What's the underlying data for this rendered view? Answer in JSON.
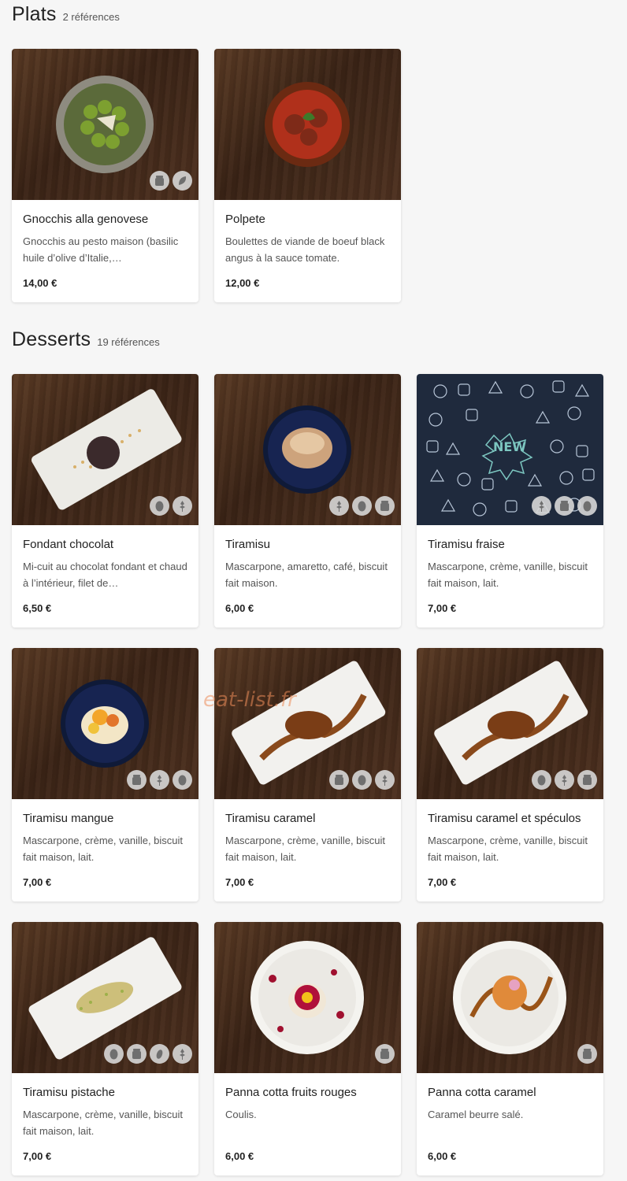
{
  "sections": {
    "plats": {
      "title": "Plats",
      "count": "2 références"
    },
    "desserts": {
      "title": "Desserts",
      "count": "19 références"
    }
  },
  "items": [
    {
      "name": "Gnocchis alla genovese",
      "desc": "Gnocchis au pesto maison (basilic huile d’olive d’Italie,…",
      "price": "14,00 €",
      "badges": [
        "jar-icon",
        "leaf-icon"
      ]
    },
    {
      "name": "Polpete",
      "desc": "Boulettes de viande de boeuf black angus à la sauce tomate.",
      "price": "12,00 €",
      "badges": []
    },
    {
      "name": "Fondant chocolat",
      "desc": "Mi-cuit au chocolat fondant et chaud à l’intérieur, filet de…",
      "price": "6,50 €",
      "badges": [
        "egg-icon",
        "wheat-icon"
      ]
    },
    {
      "name": "Tiramisu",
      "desc": "Mascarpone, amaretto, café, biscuit fait maison.",
      "price": "6,00 €",
      "badges": [
        "wheat-icon",
        "egg-icon",
        "jar-icon"
      ]
    },
    {
      "name": "Tiramisu fraise",
      "desc": "Mascarpone, crème, vanille, biscuit fait maison, lait.",
      "price": "7,00 €",
      "badges": [
        "wheat-icon",
        "jar-icon",
        "egg-icon"
      ]
    },
    {
      "name": "Tiramisu mangue",
      "desc": "Mascarpone, crème, vanille, biscuit fait maison, lait.",
      "price": "7,00 €",
      "badges": [
        "jar-icon",
        "wheat-icon",
        "egg-icon"
      ]
    },
    {
      "name": "Tiramisu caramel",
      "desc": "Mascarpone, crème, vanille, biscuit fait maison, lait.",
      "price": "7,00 €",
      "badges": [
        "jar-icon",
        "egg-icon",
        "wheat-icon"
      ]
    },
    {
      "name": "Tiramisu caramel et spéculos",
      "desc": "Mascarpone, crème, vanille, biscuit fait maison, lait.",
      "price": "7,00 €",
      "badges": [
        "egg-icon",
        "wheat-icon",
        "jar-icon"
      ]
    },
    {
      "name": "Tiramisu pistache",
      "desc": "Mascarpone, crème, vanille, biscuit fait maison, lait.",
      "price": "7,00 €",
      "badges": [
        "egg-icon",
        "jar-icon",
        "nut-icon",
        "wheat-icon"
      ]
    },
    {
      "name": "Panna cotta fruits rouges",
      "desc": "Coulis.",
      "price": "6,00 €",
      "badges": [
        "jar-icon"
      ]
    },
    {
      "name": "Panna cotta caramel",
      "desc": "Caramel beurre salé.",
      "price": "6,00 €",
      "badges": [
        "jar-icon"
      ]
    }
  ],
  "new_label": "NEW",
  "watermark": "eat-list.fr",
  "colors": {
    "wood": "#4a2e1e",
    "navy": "#1f2a3d",
    "badge": "#d7d7d7",
    "watermark": "#ec8c5a"
  }
}
